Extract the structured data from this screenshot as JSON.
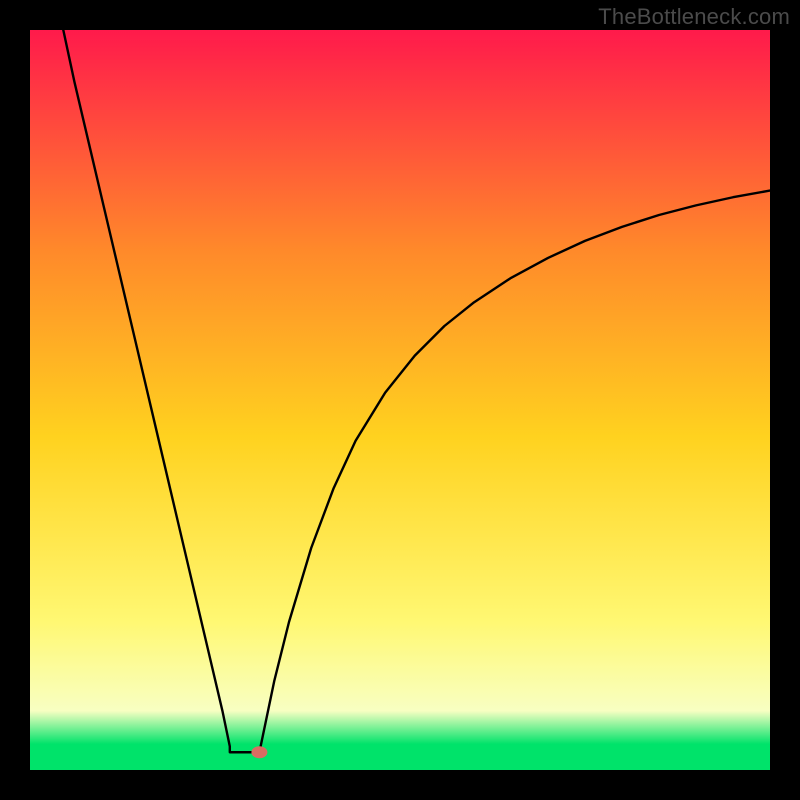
{
  "watermark": "TheBottleneck.com",
  "chart_data": {
    "type": "line",
    "title": "",
    "xlabel": "",
    "ylabel": "",
    "xlim": [
      0,
      100
    ],
    "ylim": [
      0,
      100
    ],
    "gradient_colors": {
      "top": "#ff1a4b",
      "mid_upper": "#ff8a2a",
      "mid": "#ffd21f",
      "mid_lower": "#fff873",
      "lower": "#f8ffc2",
      "bottom": "#00e36a"
    },
    "marker": {
      "x": 31,
      "y": 2.4,
      "color": "#d96c62"
    },
    "plateau": {
      "x_start": 27,
      "x_end": 30.8,
      "y": 2.4
    },
    "series": [
      {
        "name": "left-descent",
        "x": [
          4.5,
          6,
          8,
          10,
          12,
          14,
          16,
          18,
          20,
          22,
          24,
          26,
          27
        ],
        "values": [
          100,
          93,
          84.5,
          76,
          67.5,
          59,
          50.5,
          42,
          33.5,
          25,
          16.5,
          8,
          3.2
        ]
      },
      {
        "name": "right-ascent",
        "x": [
          31,
          33,
          35,
          38,
          41,
          44,
          48,
          52,
          56,
          60,
          65,
          70,
          75,
          80,
          85,
          90,
          95,
          100
        ],
        "values": [
          2.4,
          12,
          20,
          30,
          38,
          44.5,
          51,
          56,
          60,
          63.2,
          66.5,
          69.2,
          71.5,
          73.4,
          75,
          76.3,
          77.4,
          78.3
        ]
      }
    ]
  }
}
